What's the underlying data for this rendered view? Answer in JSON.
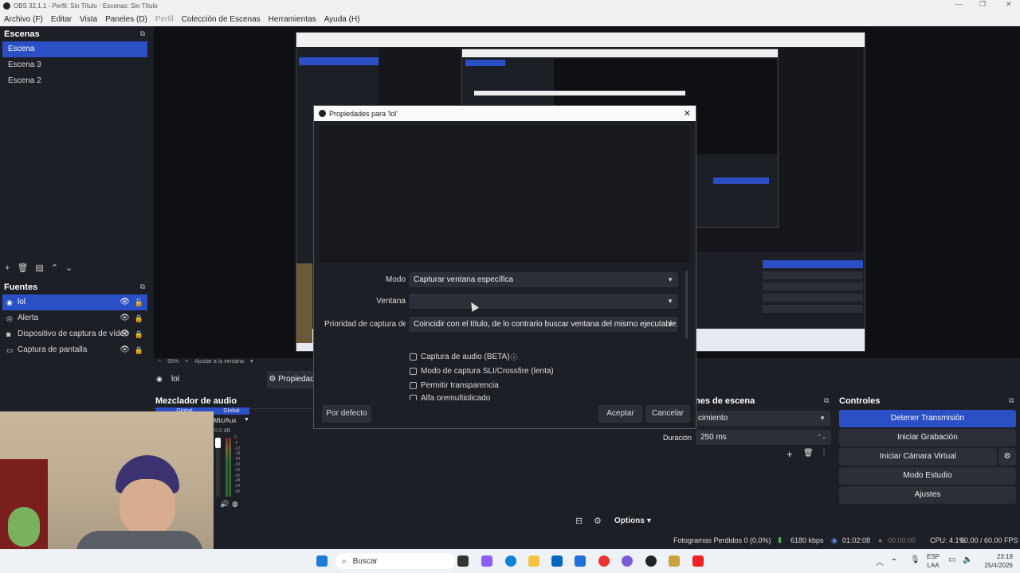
{
  "window": {
    "title": "OBS 32.1.1 - Perfil: Sin Título - Escenas: Sin Título"
  },
  "menu": [
    "Archivo (F)",
    "Editar",
    "Vista",
    "Paneles (D)",
    "Perfil",
    "Colección de Escenas",
    "Herramientas",
    "Ayuda (H)"
  ],
  "scenes": {
    "title": "Escenas",
    "items": [
      "Escena",
      "Escena 3",
      "Escena 2"
    ],
    "selected": 0
  },
  "sources": {
    "title": "Fuentes",
    "items": [
      "lol",
      "Alerta",
      "Dispositivo de captura de vídeo",
      "Captura de pantalla"
    ],
    "selected": 0
  },
  "preview": {
    "zoom": "55%",
    "zoom_mode": "Ajustar a la ventana"
  },
  "source_bar": {
    "name": "lol",
    "props_label": "Propiedad"
  },
  "mixer": {
    "title": "Mezclador de audio",
    "channel": "Mic/Aux",
    "level": "0.0 dB",
    "global": "Global",
    "ticks": [
      "0",
      "-6",
      "-12",
      "-18",
      "-24",
      "-30",
      "-36",
      "-42",
      "-48",
      "-54",
      "-60"
    ]
  },
  "transitions": {
    "title": "nes de escena",
    "type": "cimiento",
    "duration_label": "Duración",
    "duration": "250 ms"
  },
  "controls": {
    "title": "Controles",
    "buttons": [
      "Detener Transmisión",
      "Iniciar Grabación",
      "Iniciar Cámara Virtual",
      "Modo Estudio",
      "Ajustes"
    ]
  },
  "dialog": {
    "title": "Propiedades para 'lol'",
    "mode_label": "Modo",
    "mode_value": "Capturar ventana específica",
    "window_label": "Ventana",
    "window_value": "",
    "priority_label": "Prioridad de captura de ve",
    "priority_value": "Coincidir con el título, de lo contrario buscar ventana del mismo ejecutable",
    "checkboxes": [
      "Captura de audio (BETA)",
      "Modo de captura SLI/Crossfire (lenta)",
      "Permitir transparencia",
      "Alfa premultiplicado"
    ],
    "defaults_button": "Por defecto",
    "ok_button": "Aceptar",
    "cancel_button": "Cancelar"
  },
  "status": {
    "dropped": "Fotogramas Perdidos 0 (0.0%)",
    "bitrate": "6180 kbps",
    "stream_time": "01:02:08",
    "rec_time": "00:00:00",
    "cpu": "CPU: 4.1%",
    "fps": "60.00 / 60.00 FPS"
  },
  "bottom_bar": {
    "options": "Options"
  },
  "taskbar": {
    "search_placeholder": "Buscar",
    "lang_top": "ESP",
    "lang_bottom": "LAA",
    "time": "23:19",
    "date": "25/4/2026"
  },
  "colors": {
    "accent": "#2b4fc5",
    "panel": "#1d1f26",
    "button": "#2c2f37"
  }
}
